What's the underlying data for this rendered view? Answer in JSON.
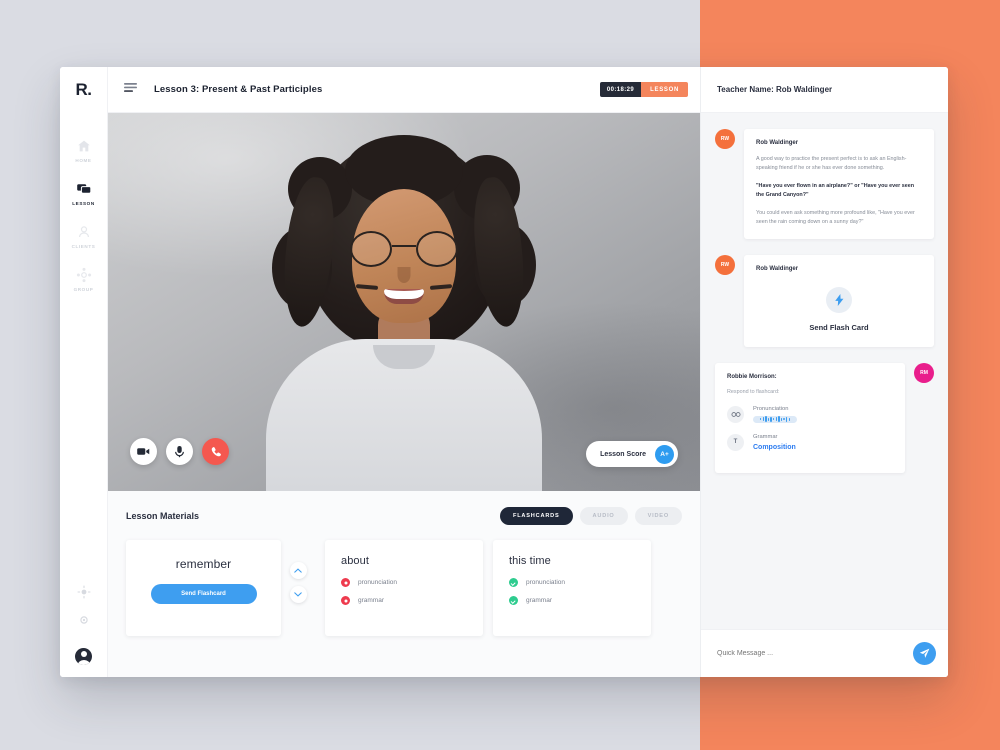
{
  "theme": {
    "background_left": "#dadce3",
    "background_right": "#f4855c",
    "accent_orange": "#f4855c",
    "accent_blue": "#3e9ef0",
    "accent_navy": "#1f2738",
    "accent_pink": "#e91e8c",
    "status_bad": "#ee3b4e",
    "status_ok": "#2ecc8f",
    "end_call_red": "#f4584f"
  },
  "rail": {
    "logo": "R.",
    "items": [
      {
        "label": "HOME",
        "icon": "home-icon",
        "active": false
      },
      {
        "label": "LESSON",
        "icon": "chat-bubbles-icon",
        "active": true
      },
      {
        "label": "CLIENTS",
        "icon": "person-icon",
        "active": false
      },
      {
        "label": "GROUP",
        "icon": "group-grid-icon",
        "active": false
      }
    ],
    "bottom": [
      {
        "icon": "brightness-icon"
      },
      {
        "icon": "gear-icon"
      }
    ],
    "avatar": "user-avatar"
  },
  "topbar": {
    "menu_icon": "hamburger-icon",
    "lesson_title": "Lesson 3: Present & Past Participles",
    "timer": "00:18:29",
    "status": "LESSON"
  },
  "video": {
    "controls": [
      {
        "name": "camera-button",
        "icon": "video-camera-icon"
      },
      {
        "name": "microphone-button",
        "icon": "microphone-icon"
      },
      {
        "name": "end-call-button",
        "icon": "phone-icon"
      }
    ],
    "score_label": "Lesson Score",
    "score_grade": "A+"
  },
  "materials": {
    "title": "Lesson Materials",
    "tabs": [
      {
        "label": "FLASHCARDS",
        "active": true
      },
      {
        "label": "AUDIO",
        "active": false
      },
      {
        "label": "VIDEO",
        "active": false
      }
    ],
    "stepper": {
      "up": "chevron-up-icon",
      "down": "chevron-down-icon"
    },
    "cards": [
      {
        "title": "remember",
        "type": "action",
        "button_label": "Send Flashcard"
      },
      {
        "title": "about",
        "type": "list",
        "items": [
          {
            "label": "pronunciation",
            "state": "bad"
          },
          {
            "label": "grammar",
            "state": "bad"
          }
        ]
      },
      {
        "title": "this time",
        "type": "list",
        "items": [
          {
            "label": "pronunciation",
            "state": "ok"
          },
          {
            "label": "grammar",
            "state": "ok"
          }
        ]
      }
    ]
  },
  "chat": {
    "header": "Teacher Name: Rob Waldinger",
    "messages": [
      {
        "type": "text",
        "side": "left",
        "avatar_initials": "RW",
        "avatar_role": "teacher",
        "name": "Rob Waldinger",
        "paragraphs": [
          {
            "text": "A good way to practice the present perfect is to ask an English-speaking friend if he or she has ever done something.",
            "bold": false
          },
          {
            "text": "\"Have you ever flown in an airplane?\" or \"Have you ever seen the Grand Canyon?\"",
            "bold": true
          },
          {
            "text": "You could even ask something more profound like, \"Have you ever seen the rain coming down on a sunny day?\"",
            "bold": false
          }
        ]
      },
      {
        "type": "flashcard",
        "side": "left",
        "avatar_initials": "RW",
        "avatar_role": "teacher",
        "name": "Rob Waldinger",
        "icon": "lightning-bolt-icon",
        "label": "Send Flash Card"
      },
      {
        "type": "response",
        "side": "right",
        "avatar_initials": "RM",
        "avatar_role": "student",
        "name": "Robbie Morrison:",
        "subtitle": "Respond to flashcard:",
        "rows": [
          {
            "icon_glyph": "∞",
            "icon_name": "audio-waveform-icon",
            "label": "Pronunciation",
            "value_type": "audio"
          },
          {
            "icon_glyph": "T",
            "icon_name": "text-icon",
            "label": "Grammar",
            "value_type": "link",
            "link_text": "Composition"
          }
        ]
      }
    ],
    "input_placeholder": "Quick Message ...",
    "send_icon": "paper-plane-icon"
  }
}
